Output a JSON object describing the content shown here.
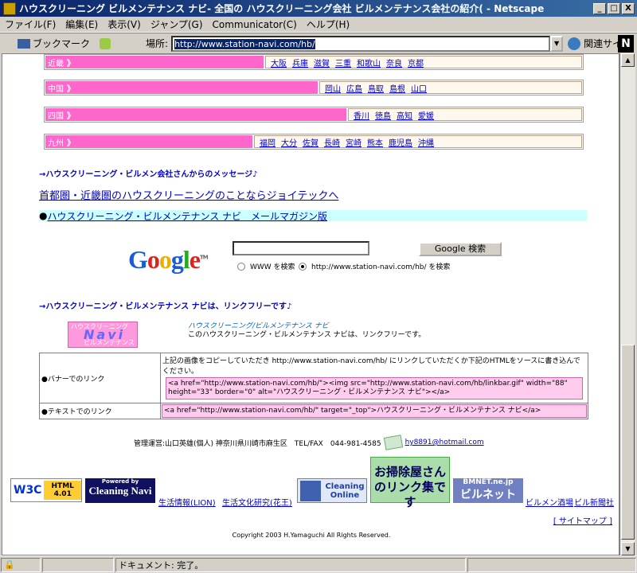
{
  "window": {
    "title": "ハウスクリーニング ビルメンテナンス ナビ- 全国の ハウスクリーニング会社 ビルメンテナンス会社の紹介( - Netscape",
    "minimize": "_",
    "maximize": "□",
    "close": "X"
  },
  "menu": [
    "ファイル(F)",
    "編集(E)",
    "表示(V)",
    "ジャンプ(G)",
    "Communicator(C)",
    "ヘルプ(H)"
  ],
  "toolbar": {
    "bookmark": "ブックマーク",
    "location_label": "場所:",
    "url": "http://www.station-navi.com/hb/",
    "related": "関連サイト"
  },
  "regions": [
    {
      "name": "近畿",
      "arrows": "》",
      "prefs": [
        "大阪",
        "兵庫",
        "滋賀",
        "三重",
        "和歌山",
        "奈良",
        "京都"
      ]
    },
    {
      "name": "中国",
      "arrows": "》",
      "prefs": [
        "岡山",
        "広島",
        "鳥取",
        "島根",
        "山口"
      ]
    },
    {
      "name": "四国",
      "arrows": "》",
      "prefs": [
        "香川",
        "徳島",
        "高知",
        "愛媛"
      ]
    },
    {
      "name": "九州",
      "arrows": "》",
      "prefs": [
        "福岡",
        "大分",
        "佐賀",
        "長崎",
        "宮崎",
        "熊本",
        "鹿児島",
        "沖縄"
      ]
    }
  ],
  "message_head": "→ハウスクリーニング・ビルメン会社さんからのメッセージ♪",
  "message_link": "首都圏・近畿圏のハウスクリーニングのことならジョイテックへ",
  "mailmag": "ハウスクリーニング・ビルメンテナンス ナビ　メールマガジン版",
  "google": {
    "logo": "Google",
    "tm": "TM",
    "button": "Google 検索",
    "opt_www": "WWW を検索",
    "opt_site": "http://www.station-navi.com/hb/ を検索"
  },
  "linkfree_head": "→ハウスクリーニング・ビルメンテナンス ナビは、リンクフリーです♪",
  "navi_logo": {
    "top": "ハウスクリーニング",
    "mid": "Navi",
    "bottom": "ビルメンテナンス"
  },
  "navi_title": "ハウスクリーニング/ビルメンテナンス ナビ",
  "navi_desc": "このハウスクリーニング・ビルメンテナンス ナビは、リンクフリーです。",
  "table": {
    "row1_label": "●バナーでのリンク",
    "row1_text": "上記の画像をコピーしていただき http://www.station-navi.com/hb/ にリンクしていただくか下記のHTMLをソースに書き込んでください。",
    "row1_code": "<a href=\"http://www.station-navi.com/hb/\"><img src=\"http://www.station-navi.com/hb/linkbar.gif\" width=\"88\" height=\"33\" border=\"0\" alt=\"ハウスクリーニング・ビルメンテナンス ナビ\"></a>",
    "row2_label": "●テキストでのリンク",
    "row2_code": "<a href=\"http://www.station-navi.com/hb/\" target=\"_top\">ハウスクリーニング・ビルメンテナンス ナビ</a>"
  },
  "admin": {
    "text": "管理運営:山口英雄(個人) 神奈川県川崎市麻生区　TEL/FAX　044-981-4585",
    "email": "hy8891@hotmail.com"
  },
  "banners": {
    "w3c": "W3C",
    "html": "HTML 4.01",
    "cn_top": "Powered by",
    "cn": "Cleaning Navi",
    "link1": "生活情報(LION)",
    "link2": "生活文化研究(花王)",
    "co": "Cleaning Online",
    "souji": "お掃除屋さんのリンク集です",
    "bm_top": "BMNET.ne.jp",
    "bm": "ビルネット",
    "link3": "ビルメン酒場",
    "link4": "ビル新聞社"
  },
  "sitemap": "[ サイトマップ ]",
  "copyright": "Copyright 2003 H.Yamaguchi All Rights Reserved.",
  "status": "ドキュメント: 完了。",
  "colors": {
    "pink": "#ff66cc",
    "cyan": "#ccffff",
    "title": "#0a246a"
  }
}
